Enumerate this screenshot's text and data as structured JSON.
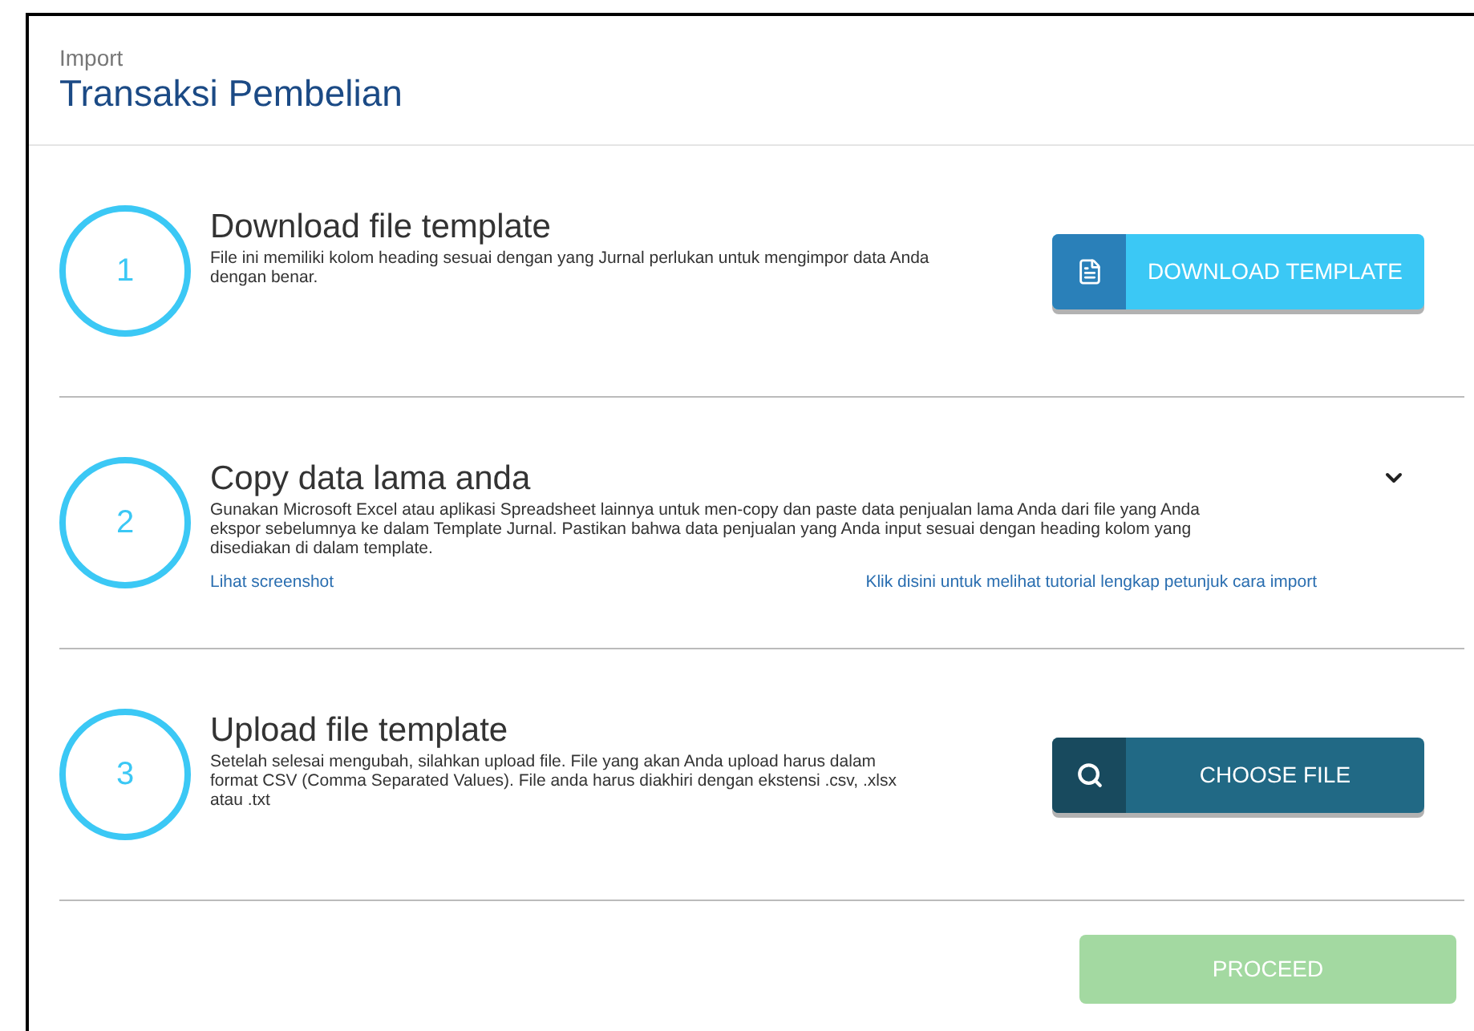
{
  "header": {
    "subtitle": "Import",
    "title": "Transaksi Pembelian"
  },
  "steps": [
    {
      "number": "1",
      "title": "Download file template",
      "description": "File ini memiliki kolom heading sesuai dengan yang Jurnal perlukan untuk mengimpor data Anda dengan benar.",
      "kind": "download",
      "button": {
        "label": "DOWNLOAD TEMPLATE"
      }
    },
    {
      "number": "2",
      "title": "Copy data lama anda",
      "description": "Gunakan Microsoft Excel atau aplikasi Spreadsheet lainnya untuk men-copy dan paste data penjualan lama Anda dari file yang Anda ekspor sebelumnya ke dalam Template Jurnal. Pastikan bahwa data penjualan yang Anda input sesuai dengan heading kolom yang disediakan di dalam template.",
      "kind": "links",
      "expanded": false,
      "links": [
        "Lihat screenshot",
        "Klik disini untuk melihat tutorial lengkap petunjuk cara import"
      ]
    },
    {
      "number": "3",
      "title": "Upload file template",
      "description": "Setelah selesai mengubah, silahkan upload file. File yang akan Anda upload harus dalam format CSV (Comma Separated Values). File anda harus diakhiri dengan ekstensi .csv, .xlsx atau .txt",
      "kind": "upload",
      "button": {
        "label": "CHOOSE FILE"
      }
    }
  ],
  "proceed": {
    "label": "PROCEED",
    "disabled": true
  }
}
